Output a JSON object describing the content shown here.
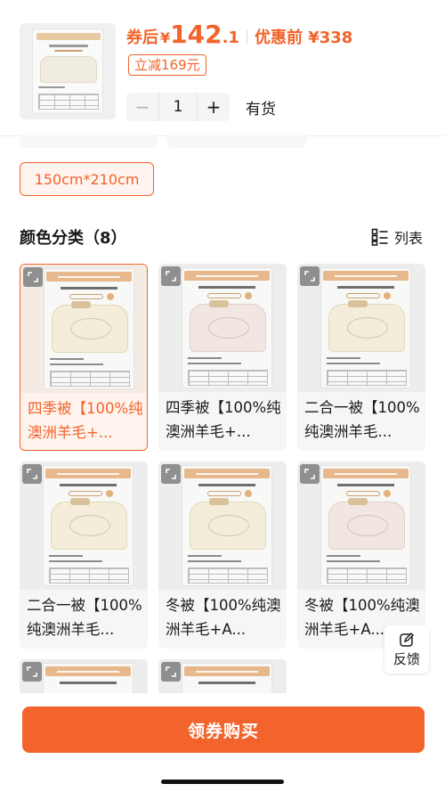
{
  "product": {
    "price_prefix": "券后",
    "currency": "¥",
    "price_integer": "142",
    "price_decimal": ".1",
    "original_price": "优惠前 ¥338",
    "discount_tag": "立减169元",
    "quantity": "1",
    "stock_status": "有货",
    "minus_label": "−",
    "plus_label": "+"
  },
  "size": {
    "selected_label": "150cm*210cm"
  },
  "color_section": {
    "title": "颜色分类（8）",
    "view_toggle_label": "列表",
    "items": [
      {
        "label": "四季被【100%纯澳洲羊毛+...",
        "selected": true,
        "tint": "cream"
      },
      {
        "label": "四季被【100%纯澳洲羊毛+...",
        "selected": false,
        "tint": "pink"
      },
      {
        "label": "二合一被【100%纯澳洲羊毛...",
        "selected": false,
        "tint": "cream"
      },
      {
        "label": "二合一被【100%纯澳洲羊毛...",
        "selected": false,
        "tint": "cream"
      },
      {
        "label": "冬被【100%纯澳洲羊毛+A...",
        "selected": false,
        "tint": "cream"
      },
      {
        "label": "冬被【100%纯澳洲羊毛+A...",
        "selected": false,
        "tint": "pink"
      },
      {
        "label": "",
        "selected": false,
        "tint": "cream"
      },
      {
        "label": "",
        "selected": false,
        "tint": "pink"
      }
    ]
  },
  "feedback": {
    "label": "反馈"
  },
  "bottom_bar": {
    "buy_label": "领券购买"
  },
  "colors": {
    "accent": "#f2642b",
    "accent_light": "#fff4ef"
  },
  "icons": [
    "zoom-icon",
    "list-view-icon",
    "edit-feedback-icon"
  ]
}
